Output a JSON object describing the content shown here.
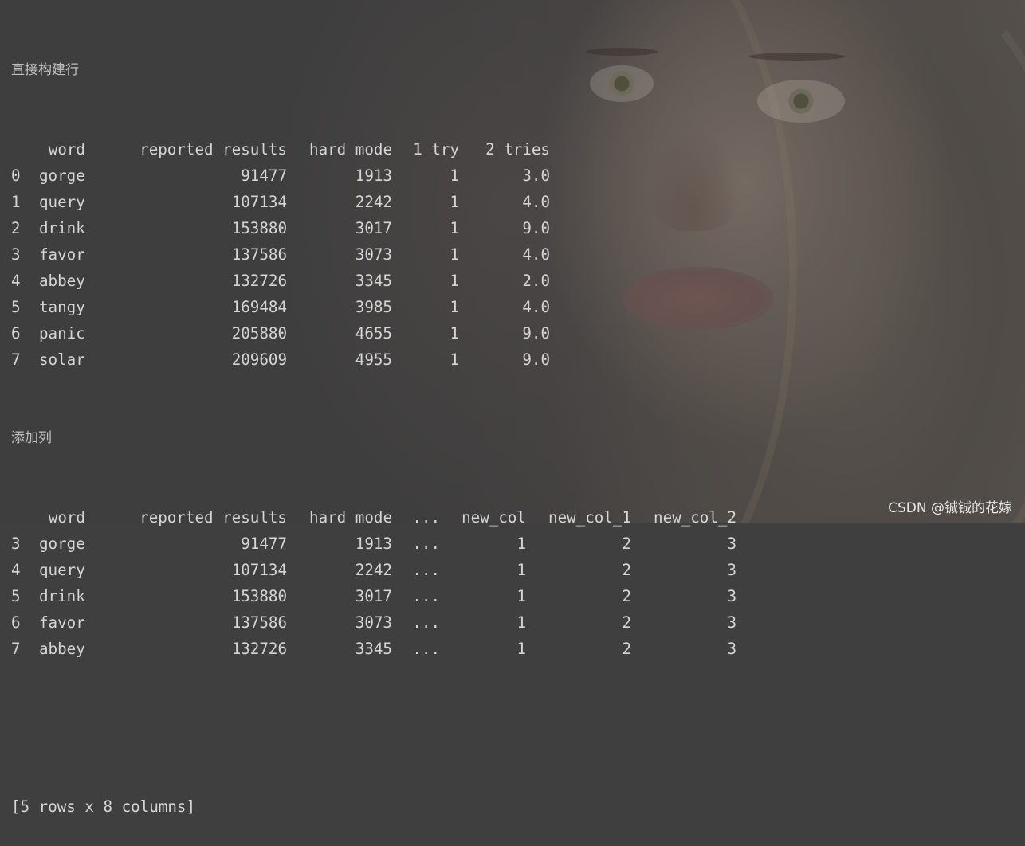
{
  "section1": {
    "title": "直接构建行",
    "headers": [
      "",
      "word",
      "reported results",
      "hard mode",
      "1 try",
      "2 tries"
    ],
    "rows": [
      [
        "0",
        "gorge",
        "91477",
        "1913",
        "1",
        "3.0"
      ],
      [
        "1",
        "query",
        "107134",
        "2242",
        "1",
        "4.0"
      ],
      [
        "2",
        "drink",
        "153880",
        "3017",
        "1",
        "9.0"
      ],
      [
        "3",
        "favor",
        "137586",
        "3073",
        "1",
        "4.0"
      ],
      [
        "4",
        "abbey",
        "132726",
        "3345",
        "1",
        "2.0"
      ],
      [
        "5",
        "tangy",
        "169484",
        "3985",
        "1",
        "4.0"
      ],
      [
        "6",
        "panic",
        "205880",
        "4655",
        "1",
        "9.0"
      ],
      [
        "7",
        "solar",
        "209609",
        "4955",
        "1",
        "9.0"
      ]
    ]
  },
  "section2": {
    "title": "添加列",
    "headers": [
      "",
      "word",
      "reported results",
      "hard mode",
      "...",
      "new_col",
      "new_col_1",
      "new_col_2"
    ],
    "rows": [
      [
        "3",
        "gorge",
        "91477",
        "1913",
        "...",
        "1",
        "2",
        "3"
      ],
      [
        "4",
        "query",
        "107134",
        "2242",
        "...",
        "1",
        "2",
        "3"
      ],
      [
        "5",
        "drink",
        "153880",
        "3017",
        "...",
        "1",
        "2",
        "3"
      ],
      [
        "6",
        "favor",
        "137586",
        "3073",
        "...",
        "1",
        "2",
        "3"
      ],
      [
        "7",
        "abbey",
        "132726",
        "3345",
        "...",
        "1",
        "2",
        "3"
      ]
    ]
  },
  "summary": "[5 rows x 8 columns]",
  "watermark": "CSDN @铖铖的花嫁"
}
